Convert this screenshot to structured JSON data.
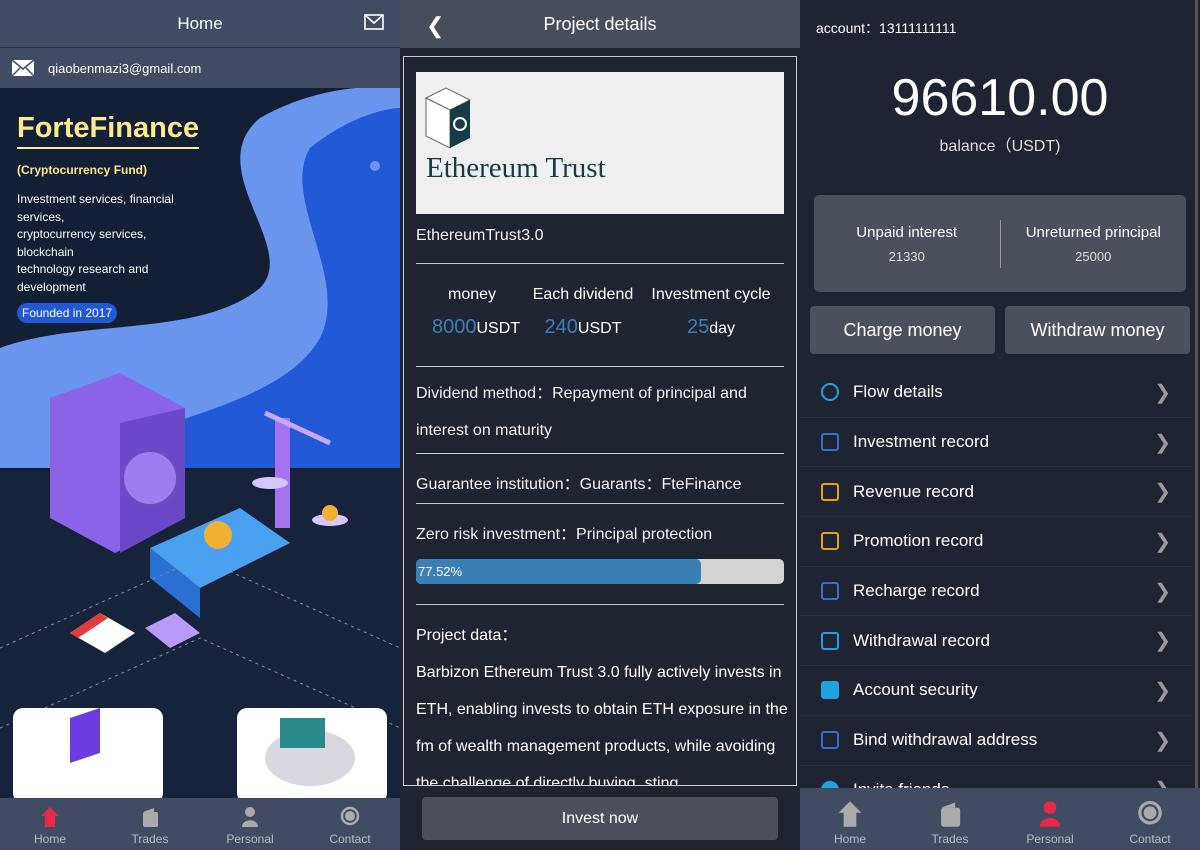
{
  "home": {
    "title": "Home",
    "email": "qiaobenmazi3@gmail.com",
    "brand": "ForteFinance",
    "subtitle": "(Cryptocurrency Fund)",
    "description_lines": [
      "Investment services, financial services,",
      "cryptocurrency services, blockchain",
      "technology research and development"
    ],
    "founded": "Founded in 2017"
  },
  "nav": {
    "items": [
      {
        "label": "Home",
        "icon": "home-icon"
      },
      {
        "label": "Trades",
        "icon": "wallet-icon"
      },
      {
        "label": "Personal",
        "icon": "person-icon"
      },
      {
        "label": "Contact",
        "icon": "headset-icon"
      }
    ],
    "active_color": "#e8294a",
    "home_active": "Home",
    "personal_active": "Personal"
  },
  "project": {
    "title": "Project details",
    "banner_text": "Ethereum Trust",
    "name": "EthereumTrust3.0",
    "stats": [
      {
        "label": "money",
        "value": "8000",
        "unit": "USDT"
      },
      {
        "label": "Each dividend",
        "value": "240",
        "unit": "USDT"
      },
      {
        "label": "Investment cycle",
        "value": "25",
        "unit": "day"
      }
    ],
    "dividend_method": "Dividend method：Repayment of principal and interest on maturity",
    "guarantee": "Guarantee institution：Guarants：FteFinance",
    "risk": "Zero risk investment：Principal protection",
    "progress_percent": 77.52,
    "progress_label": "77.52%",
    "data_title": "Project data：",
    "data_text": "Barbizon Ethereum Trust 3.0 fully actively invests in ETH, enabling invests to obtain ETH exposure in the fm of wealth management products, while avoiding the challenge of directly buying, sting",
    "invest_button": "Invest now"
  },
  "personal": {
    "account": "account：13111111111",
    "balance": "96610.00",
    "balance_label": "balance（USDT)",
    "unpaid_label": "Unpaid interest",
    "unpaid_value": "21330",
    "unreturned_label": "Unreturned principal",
    "unreturned_value": "25000",
    "charge": "Charge money",
    "withdraw": "Withdraw money",
    "menu": [
      {
        "label": "Flow details",
        "icon": "yen-circle-icon",
        "color": "#1fa2e0"
      },
      {
        "label": "Investment record",
        "icon": "clipboard-yen-icon",
        "color": "#3a6fc8"
      },
      {
        "label": "Revenue record",
        "icon": "document-icon",
        "color": "#e2a21c"
      },
      {
        "label": "Promotion record",
        "icon": "document-icon",
        "color": "#e2a21c"
      },
      {
        "label": "Recharge record",
        "icon": "clipboard-icon",
        "color": "#3a6fc8"
      },
      {
        "label": "Withdrawal record",
        "icon": "wallet-icon",
        "color": "#1fa2e0"
      },
      {
        "label": "Account security",
        "icon": "shield-check-icon",
        "color": "#1fa2e0"
      },
      {
        "label": "Bind withdrawal address",
        "icon": "card-icon",
        "color": "#3a6fc8"
      },
      {
        "label": "Invite friends",
        "icon": "person-icon",
        "color": "#1fa2e0"
      }
    ]
  }
}
